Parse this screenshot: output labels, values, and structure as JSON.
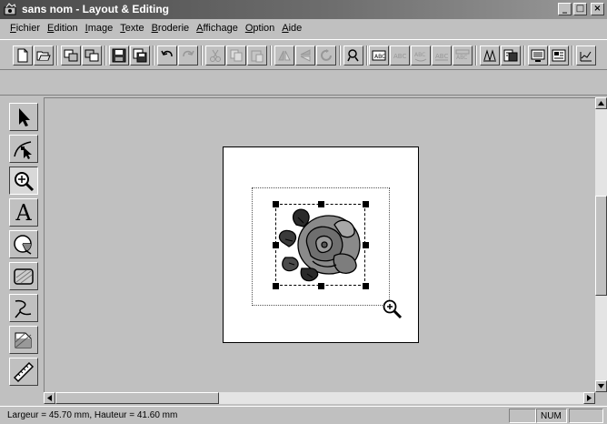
{
  "window": {
    "title": "sans nom - Layout & Editing",
    "icon": "app-embroidery-icon",
    "minimize": "_",
    "maximize": "□",
    "close": "×"
  },
  "menu": {
    "items": [
      {
        "acc": "F",
        "rest": "ichier"
      },
      {
        "acc": "E",
        "rest": "dition"
      },
      {
        "acc": "I",
        "rest": "mage"
      },
      {
        "acc": "T",
        "rest": "exte"
      },
      {
        "acc": "B",
        "rest": "roderie"
      },
      {
        "acc": "A",
        "rest": "ffichage"
      },
      {
        "acc": "O",
        "rest": "ption"
      },
      {
        "acc": "A",
        "rest": "ide"
      }
    ]
  },
  "toolbar": {
    "buttons": [
      "new-file-icon",
      "open-folder-icon",
      "import-icon",
      "import-alt-icon",
      "save-icon",
      "save-as-icon",
      "undo-icon",
      "redo-icon",
      "cut-icon",
      "copy-icon",
      "paste-icon",
      "mirror-horizontal-icon",
      "mirror-vertical-icon",
      "rotate-icon",
      "stitch-icon",
      "text-layout-icon",
      "text-disabled-1-icon",
      "text-disabled-2-icon",
      "text-disabled-3-icon",
      "text-disabled-4-icon",
      "sew-simulator-icon",
      "card-write-icon",
      "display-icon",
      "card-icon",
      "design-property-icon"
    ]
  },
  "tools": [
    {
      "name": "select-tool",
      "icon": "arrow-icon"
    },
    {
      "name": "point-edit-tool",
      "icon": "node-edit-icon"
    },
    {
      "name": "zoom-tool",
      "icon": "magnifier-icon",
      "active": true
    },
    {
      "name": "text-tool",
      "icon": "letter-a-icon",
      "glyph": "A"
    },
    {
      "name": "circle-arc-tool",
      "icon": "circle-arc-icon"
    },
    {
      "name": "rectangle-tool",
      "icon": "rectangle-icon"
    },
    {
      "name": "curve-tool",
      "icon": "curve-icon"
    },
    {
      "name": "fill-tool",
      "icon": "fill-icon"
    },
    {
      "name": "measure-tool",
      "icon": "ruler-icon"
    }
  ],
  "canvas": {
    "design": "rose-embroidery",
    "cursor": "zoom-in-cursor"
  },
  "status": {
    "dimensions": "Largeur  = 45.70 mm, Hauteur = 41.60 mm",
    "num": "NUM"
  }
}
